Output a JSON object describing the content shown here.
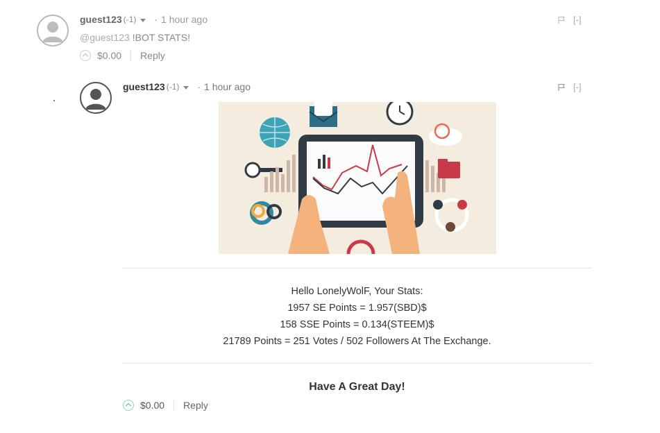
{
  "parent_comment": {
    "author": "guest123",
    "reputation": "(-1)",
    "separator": "·",
    "time": "1 hour ago",
    "collapse_label": "[-]",
    "mention": "@guest123",
    "text": " !BOT STATS!",
    "payout": "$0.00",
    "reply_label": "Reply"
  },
  "reply_comment": {
    "author": "guest123",
    "reputation": "(-1)",
    "separator": "·",
    "time": "1 hour ago",
    "collapse_label": "[-]",
    "stats_lines": [
      "Hello LonelyWolF, Your Stats:",
      "1957 SE Points = 1.957(SBD)$",
      "158 SSE Points = 0.134(STEEM)$",
      "21789 Points = 251 Votes / 502 Followers At The Exchange."
    ],
    "closing": "Have A Great Day!",
    "payout": "$0.00",
    "reply_label": "Reply"
  },
  "colors": {
    "upvote_accent": "#4bc296",
    "image_background": "#f5ece0"
  },
  "icons": {
    "avatar": "user-avatar-icon",
    "caret": "chevron-down-icon",
    "flag": "flag-icon",
    "upvote": "upvote-icon"
  }
}
